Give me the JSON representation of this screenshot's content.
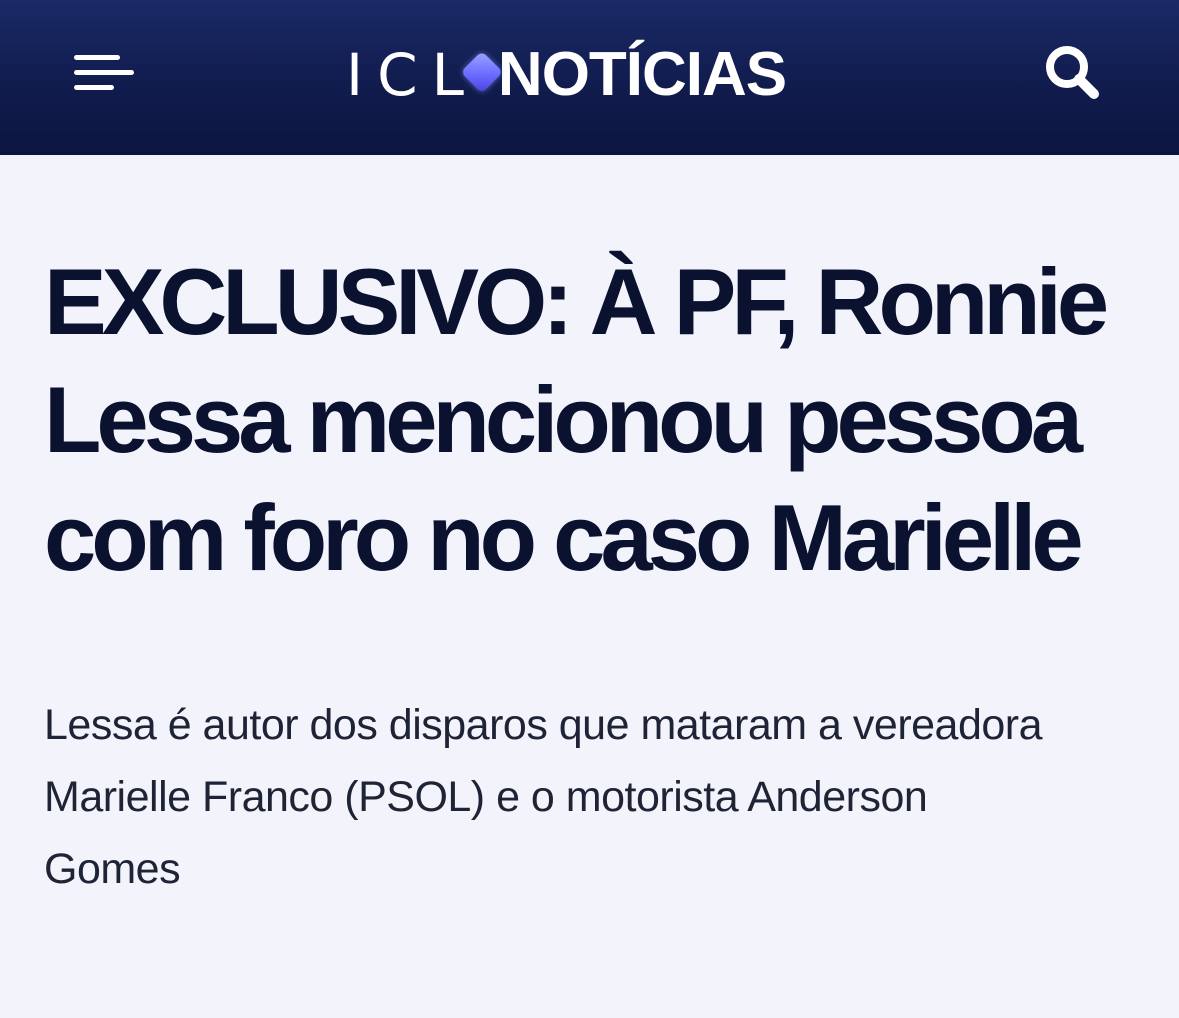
{
  "header": {
    "menu_icon": "hamburger-menu-icon",
    "logo": {
      "prefix": "ICL",
      "name": "NOTÍCIAS"
    },
    "search_icon": "search-icon",
    "colors": {
      "background": "#111c4e",
      "logo_accent": "#6a6dff"
    }
  },
  "article": {
    "headline": "EXCLUSIVO: À PF, Ronnie Lessa mencionou pessoa com foro no caso Marielle",
    "subtitle": "Lessa é autor dos disparos que mataram a vereadora Marielle Franco (PSOL) e o motorista Anderson Gomes"
  }
}
